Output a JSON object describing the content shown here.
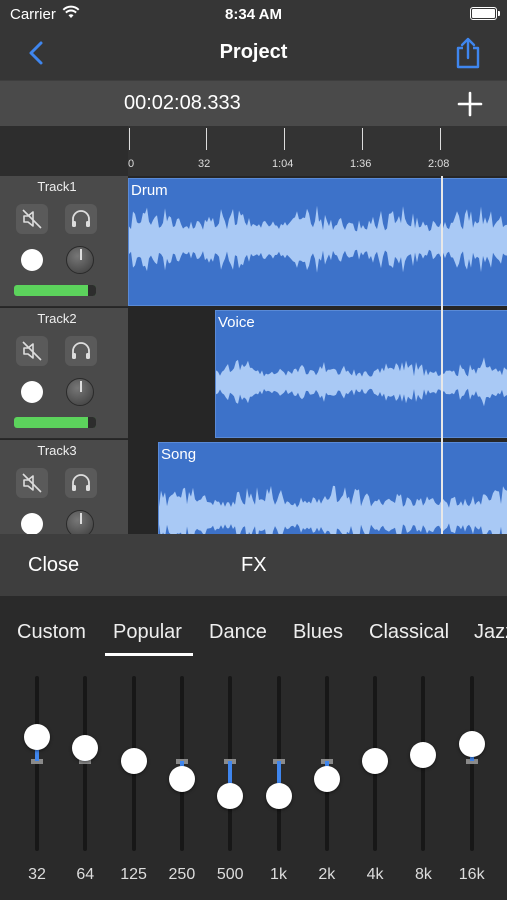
{
  "status": {
    "carrier": "Carrier",
    "time": "8:34 AM"
  },
  "nav": {
    "title": "Project"
  },
  "timeline": {
    "timecode": "00:02:08.333",
    "ruler_labels": [
      "0",
      "32",
      "1:04",
      "1:36",
      "2:08"
    ]
  },
  "tracks": [
    {
      "name": "Track1",
      "clip": "Drum",
      "level_percent": 90
    },
    {
      "name": "Track2",
      "clip": "Voice",
      "level_percent": 90
    },
    {
      "name": "Track3",
      "clip": "Song"
    }
  ],
  "fx_bar": {
    "close_label": "Close",
    "title": "FX"
  },
  "eq": {
    "presets": [
      "Custom",
      "Popular",
      "Dance",
      "Blues",
      "Classical",
      "Jazz"
    ],
    "selected_preset": "Popular",
    "bands": [
      {
        "label": "32",
        "gain": 0.35
      },
      {
        "label": "64",
        "gain": 0.18
      },
      {
        "label": "125",
        "gain": 0.0
      },
      {
        "label": "250",
        "gain": -0.25
      },
      {
        "label": "500",
        "gain": -0.5
      },
      {
        "label": "1k",
        "gain": -0.5
      },
      {
        "label": "2k",
        "gain": -0.25
      },
      {
        "label": "4k",
        "gain": 0.0
      },
      {
        "label": "8k",
        "gain": 0.08
      },
      {
        "label": "16k",
        "gain": 0.25
      }
    ]
  },
  "colors": {
    "accent": "#3f86ee",
    "clip": "#3d72c9",
    "meter": "#5cd35c"
  },
  "icons": [
    "back-chevron-icon",
    "share-icon",
    "add-icon",
    "mute-icon",
    "headphones-icon",
    "record-icon",
    "pan-knob-icon"
  ]
}
